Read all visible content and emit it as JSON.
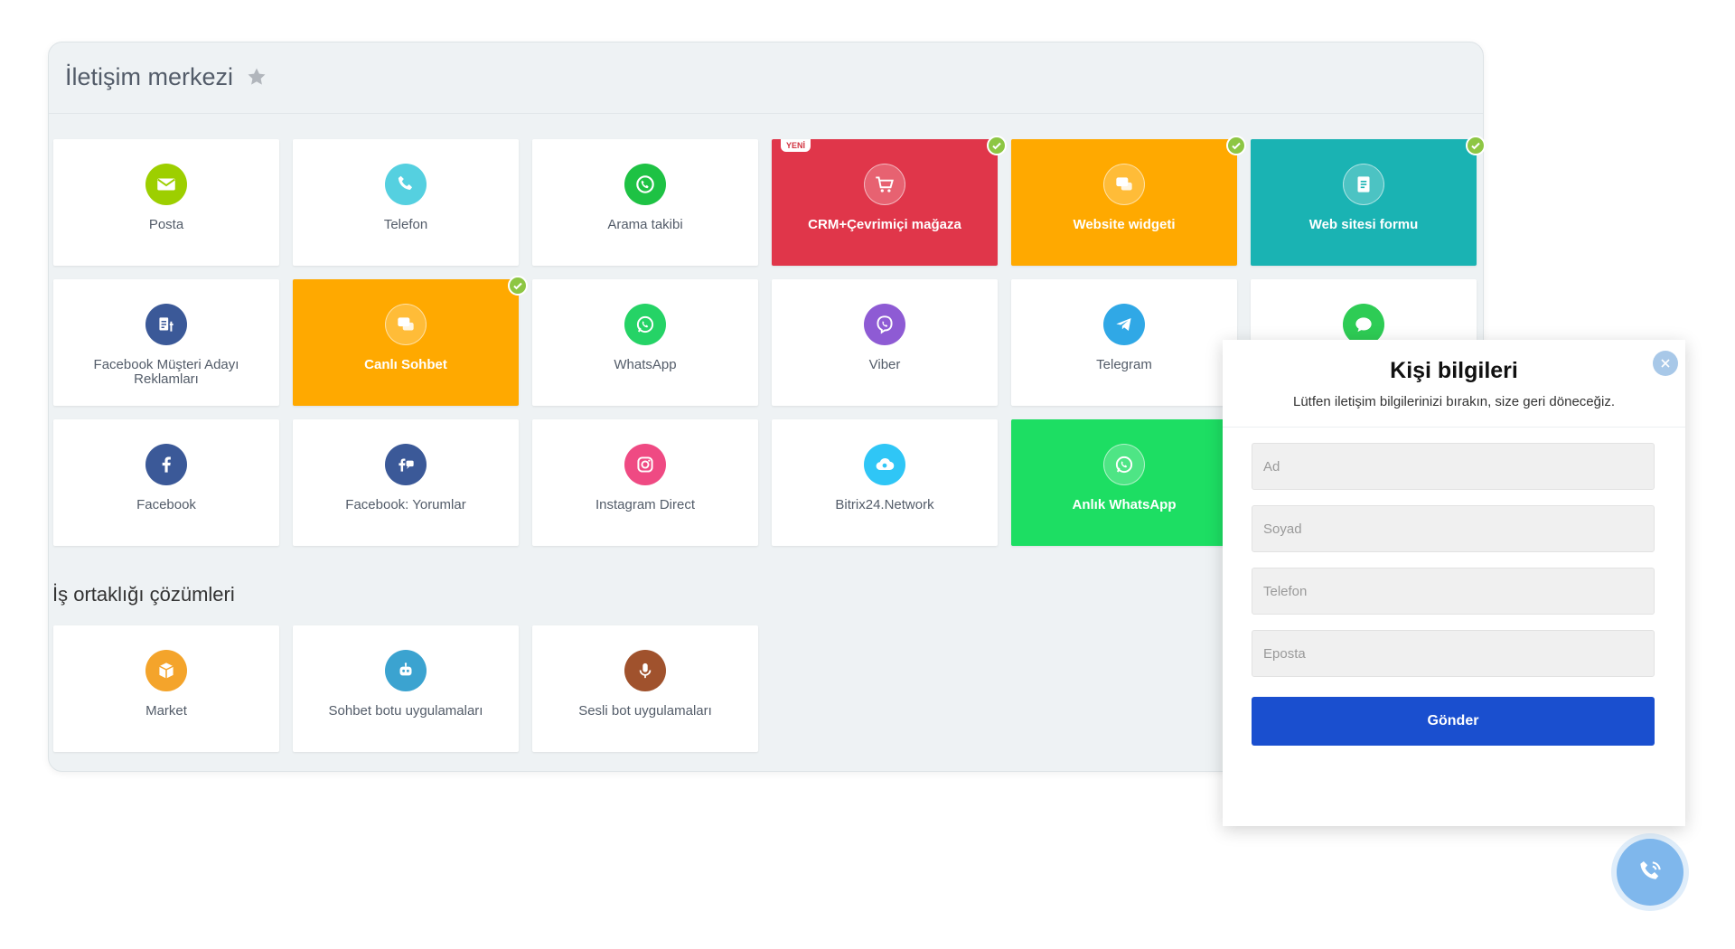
{
  "header": {
    "title": "İletişim merkezi"
  },
  "tiles": [
    {
      "label": "Posta",
      "icon": "mail-icon",
      "color": "#9dcf00"
    },
    {
      "label": "Telefon",
      "icon": "phone-icon",
      "color": "#55d0e0"
    },
    {
      "label": "Arama takibi",
      "icon": "call-tracking-icon",
      "color": "#1ec244"
    },
    {
      "label": "CRM+Çevrimiçi mağaza",
      "icon": "cart-icon",
      "color": "#e0364a",
      "badge": "YENİ"
    },
    {
      "label": "Website widgeti",
      "icon": "chat-bubbles-icon",
      "color": "#ffa900"
    },
    {
      "label": "Web sitesi formu",
      "icon": "form-icon",
      "color": "#1ab3b3"
    },
    {
      "label": "Facebook Müşteri Adayı Reklamları",
      "icon": "facebook-leads-icon",
      "color": "#3b5998"
    },
    {
      "label": "Canlı Sohbet",
      "icon": "live-chat-icon",
      "color": "#ffa900"
    },
    {
      "label": "WhatsApp",
      "icon": "whatsapp-icon",
      "color": "#25d366"
    },
    {
      "label": "Viber",
      "icon": "viber-icon",
      "color": "#8e5bd4"
    },
    {
      "label": "Telegram",
      "icon": "telegram-icon",
      "color": "#30a8e6"
    },
    {
      "label": "",
      "icon": "message-icon",
      "color": "#2ecc55"
    },
    {
      "label": "Facebook",
      "icon": "facebook-icon",
      "color": "#3b5998"
    },
    {
      "label": "Facebook: Yorumlar",
      "icon": "facebook-comments-icon",
      "color": "#3b5998"
    },
    {
      "label": "Instagram Direct",
      "icon": "instagram-icon",
      "color": "#ef4a83"
    },
    {
      "label": "Bitrix24.Network",
      "icon": "cloud-icon",
      "color": "#2fc6f6"
    },
    {
      "label": "Anlık WhatsApp",
      "icon": "whatsapp-icon",
      "color": "#1dde63"
    }
  ],
  "partner_section": {
    "title": "İş ortaklığı çözümleri"
  },
  "partner_tiles": [
    {
      "label": "Market",
      "icon": "box-icon",
      "color": "#f4a42b"
    },
    {
      "label": "Sohbet botu uygulamaları",
      "icon": "robot-icon",
      "color": "#3ba3d0"
    },
    {
      "label": "Sesli bot uygulamaları",
      "icon": "microphone-icon",
      "color": "#a0522d"
    }
  ],
  "form": {
    "title": "Kişi bilgileri",
    "subtitle": "Lütfen iletişim bilgilerinizi bırakın, size geri döneceğiz.",
    "fields": [
      {
        "placeholder": "Ad",
        "value": ""
      },
      {
        "placeholder": "Soyad",
        "value": ""
      },
      {
        "placeholder": "Telefon",
        "value": ""
      },
      {
        "placeholder": "Eposta",
        "value": ""
      }
    ],
    "submit_label": "Gönder"
  }
}
